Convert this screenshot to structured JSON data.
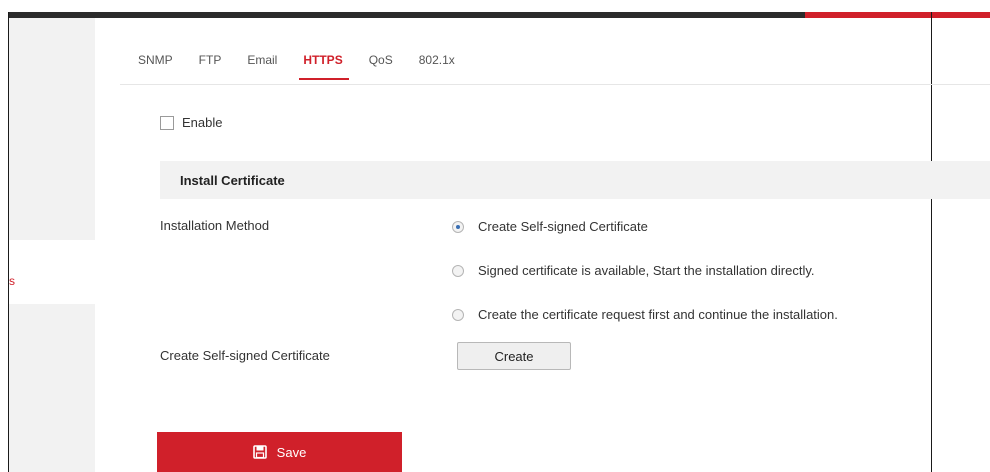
{
  "sidebar": {
    "active_item_fragment": "s"
  },
  "tabs": [
    {
      "label": "SNMP"
    },
    {
      "label": "FTP"
    },
    {
      "label": "Email"
    },
    {
      "label": "HTTPS",
      "active": true
    },
    {
      "label": "QoS"
    },
    {
      "label": "802.1x"
    }
  ],
  "enable": {
    "label": "Enable",
    "checked": false
  },
  "section": {
    "title": "Install Certificate"
  },
  "installation": {
    "label": "Installation Method",
    "options": [
      {
        "label": "Create Self-signed Certificate",
        "checked": true
      },
      {
        "label": "Signed certificate is available, Start the installation directly.",
        "checked": false
      },
      {
        "label": "Create the certificate request first and continue the installation.",
        "checked": false
      }
    ]
  },
  "self_signed": {
    "label": "Create Self-signed Certificate",
    "button": "Create"
  },
  "save": {
    "label": "Save",
    "icon": "save-icon"
  },
  "colors": {
    "accent": "#d0202a",
    "topbar": "#2b2b2b",
    "section_bg": "#f2f2f2"
  }
}
